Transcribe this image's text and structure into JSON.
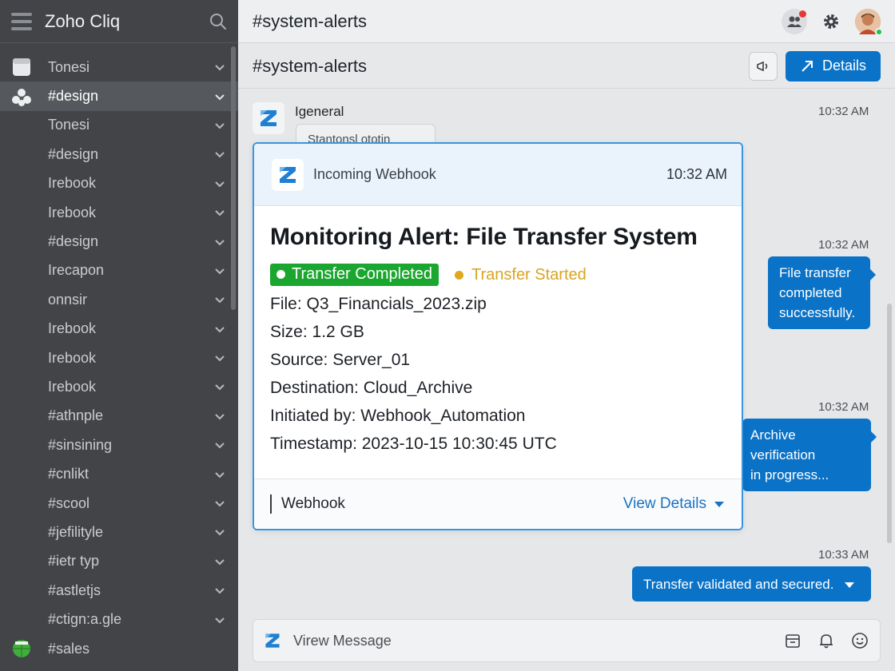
{
  "app": {
    "name": "Zoho Cliq"
  },
  "header": {
    "title": "#system-alerts"
  },
  "channel": {
    "title": "#system-alerts",
    "details_label": "Details"
  },
  "sidebar": {
    "items": [
      {
        "label": "Tonesi",
        "icon": "note-icon"
      },
      {
        "label": "#design",
        "icon": "group-icon",
        "active": true
      },
      {
        "label": "Tonesi"
      },
      {
        "label": "#design"
      },
      {
        "label": "Irebook"
      },
      {
        "label": "Irebook"
      },
      {
        "label": "#design"
      },
      {
        "label": "Irecapon"
      },
      {
        "label": "onnsir"
      },
      {
        "label": "Irebook"
      },
      {
        "label": "Irebook"
      },
      {
        "label": "Irebook"
      },
      {
        "label": "#athnple"
      },
      {
        "label": "#sinsining"
      },
      {
        "label": "#cnlikt"
      },
      {
        "label": "#scool"
      },
      {
        "label": "#jefilityle"
      },
      {
        "label": "#ietr typ"
      },
      {
        "label": "#astletjs"
      },
      {
        "label": "#ctign:a.gle"
      },
      {
        "label": "#sales",
        "icon": "globe-icon"
      }
    ]
  },
  "messages": {
    "first": {
      "sender": "Igeneral",
      "time": "10:32 AM",
      "preview": "Stantonsl ototin"
    },
    "bubble1": {
      "time": "10:32 AM",
      "lines": [
        "File transfer",
        "completed",
        "successfully."
      ]
    },
    "bubble2": {
      "time": "10:32 AM",
      "lines": [
        "Archive verification",
        "in progress..."
      ]
    },
    "bubble3": {
      "time": "10:33 AM",
      "text": "Transfer validated and secured."
    }
  },
  "webhook": {
    "sender": "Incoming Webhook",
    "time": "10:32 AM",
    "title": "Monitoring Alert: File Transfer System",
    "status_completed": "Transfer Completed",
    "status_started": "Transfer Started",
    "fields": [
      "File: Q3_Financials_2023.zip",
      "Size: 1.2 GB",
      "Source: Server_01",
      "Destination: Cloud_Archive",
      "Initiated by: Webhook_Automation",
      "Timestamp: 2023-10-15 10:30:45 UTC"
    ],
    "footer_source": "Webhook",
    "view_details": "View Details"
  },
  "composer": {
    "placeholder": "Virew Message"
  },
  "colors": {
    "accent": "#0a73c8",
    "sidebar": "#424448",
    "success": "#1aa62f",
    "warning": "#e0a820"
  }
}
